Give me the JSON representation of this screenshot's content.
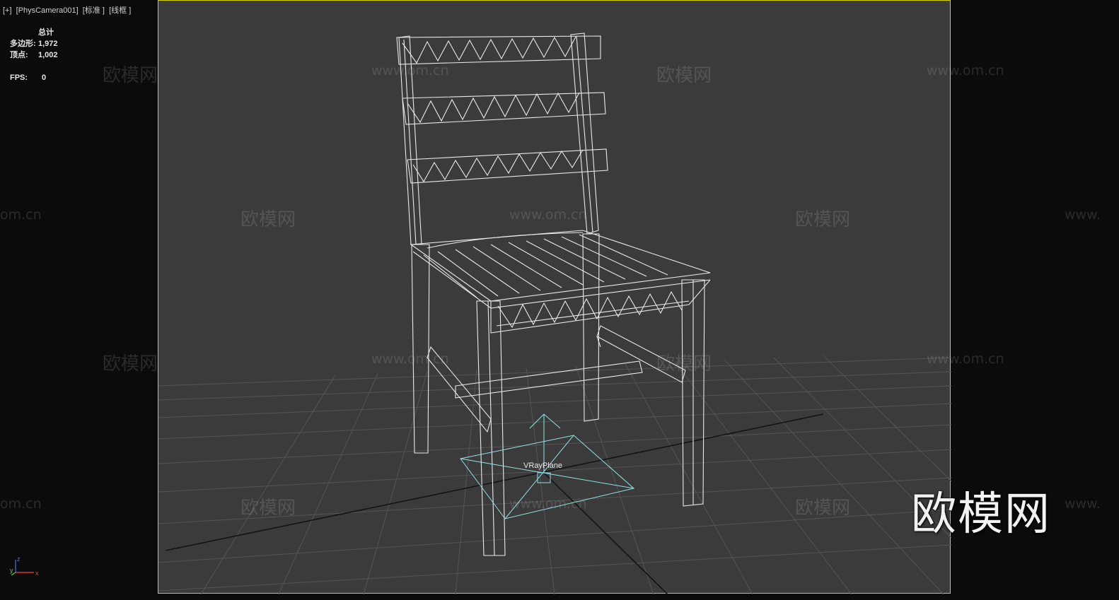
{
  "viewport": {
    "label": "[+]  [PhysCamera001]  [标准 ]  [线框 ]",
    "border_color": "#d7d000",
    "background": "#3b3b3b"
  },
  "stats": {
    "header": "总计",
    "polygons_label": "多边形:",
    "polygons_value": "1,972",
    "vertices_label": "顶点:",
    "vertices_value": "1,002",
    "fps_label": "FPS:",
    "fps_value": "0"
  },
  "scene": {
    "object_label": "VRayPlane",
    "wire_color": "#e9e9e9",
    "helper_color": "#8fe3e6"
  },
  "watermarks": {
    "cn": "欧模网",
    "url": "www.om.cn",
    "url_partial_left": "om.cn",
    "url_partial_right": "www."
  },
  "logo": {
    "text": "欧模网"
  },
  "axis": {
    "x": "x",
    "y": "y",
    "z": "z"
  }
}
